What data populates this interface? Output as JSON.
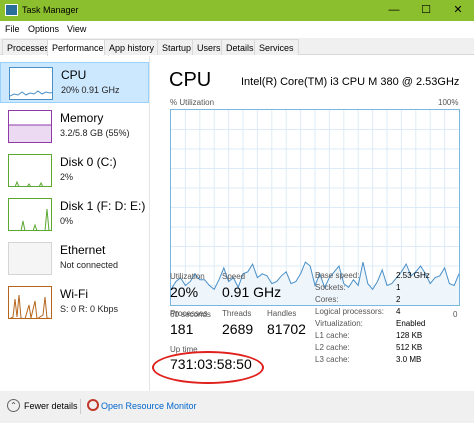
{
  "window": {
    "title": "Task Manager",
    "min": "—",
    "max": "☐",
    "close": "✕"
  },
  "menu": [
    "File",
    "Options",
    "View"
  ],
  "tabs": [
    "Processes",
    "Performance",
    "App history",
    "Startup",
    "Users",
    "Details",
    "Services"
  ],
  "active_tab": "Performance",
  "resources": [
    {
      "name": "CPU",
      "detail": "20% 0.91 GHz",
      "color": "#4a90c8",
      "selected": true
    },
    {
      "name": "Memory",
      "detail": "3.2/5.8 GB (55%)",
      "color": "#8e3aa8"
    },
    {
      "name": "Disk 0 (C:)",
      "detail": "2%",
      "color": "#5aa832"
    },
    {
      "name": "Disk 1 (F: D: E:)",
      "detail": "0%",
      "color": "#5aa832"
    },
    {
      "name": "Ethernet",
      "detail": "Not connected",
      "color": "#bdbdbd"
    },
    {
      "name": "Wi-Fi",
      "detail": "S: 0 R: 0 Kbps",
      "color": "#b5651d"
    }
  ],
  "cpu": {
    "heading": "CPU",
    "model": "Intel(R) Core(TM) i3 CPU M 380 @ 2.53GHz",
    "util_label": "% Utilization",
    "util_max": "100%",
    "axis_left": "60 seconds",
    "axis_right": "0",
    "utilization_percent": [
      8,
      12,
      14,
      10,
      12,
      16,
      13,
      13,
      10,
      8,
      13,
      19,
      12,
      14,
      9,
      16,
      17,
      21,
      14,
      16,
      15,
      11,
      12,
      15,
      17,
      11,
      12,
      16,
      22,
      20,
      10,
      16,
      9,
      14,
      17,
      20,
      11,
      9,
      13,
      10,
      22,
      11,
      8,
      12,
      18,
      10,
      11,
      14,
      17,
      21,
      15,
      17,
      20,
      16,
      11,
      14,
      15,
      19,
      11,
      10,
      16
    ]
  },
  "stats": {
    "utilization_label": "Utilization",
    "utilization": "20%",
    "speed_label": "Speed",
    "speed": "0.91 GHz",
    "processes_label": "Processes",
    "processes": "181",
    "threads_label": "Threads",
    "threads": "2689",
    "handles_label": "Handles",
    "handles": "81702",
    "uptime_label": "Up time",
    "uptime": "731:03:58:50"
  },
  "specs": [
    {
      "label": "Base speed:",
      "value": "2.53 GHz"
    },
    {
      "label": "Sockets:",
      "value": "1"
    },
    {
      "label": "Cores:",
      "value": "2"
    },
    {
      "label": "Logical processors:",
      "value": "4"
    },
    {
      "label": "Virtualization:",
      "value": "Enabled"
    },
    {
      "label": "L1 cache:",
      "value": "128 KB"
    },
    {
      "label": "L2 cache:",
      "value": "512 KB"
    },
    {
      "label": "L3 cache:",
      "value": "3.0 MB"
    }
  ],
  "footer": {
    "fewer_details": "Fewer details",
    "fewer_icon": "chevron-up-icon",
    "open_monitor": "Open Resource Monitor"
  },
  "colors": {
    "titlebar": "#8cbf2e",
    "graph_line": "#4a90c8",
    "graph_fill": "#eef5fb",
    "annotation": "#e0201c"
  }
}
